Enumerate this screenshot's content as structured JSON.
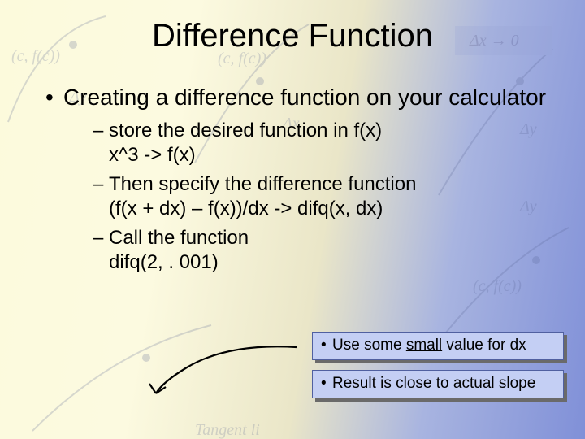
{
  "title": "Difference Function",
  "main_bullet": "Creating a difference function on your calculator",
  "sub": [
    {
      "a": "store the desired function in f(x)",
      "b": "x^3 -> f(x)"
    },
    {
      "a": " Then specify the difference function",
      "b": "(f(x + dx) – f(x))/dx -> difq(x, dx)"
    },
    {
      "a": "Call the function",
      "b": "difq(2, . 001)"
    }
  ],
  "callout1": {
    "pre": "Use some ",
    "u": "small",
    "post": " value for dx"
  },
  "callout2": {
    "pre": "Result is ",
    "u": "close",
    "post": " to actual slope"
  }
}
